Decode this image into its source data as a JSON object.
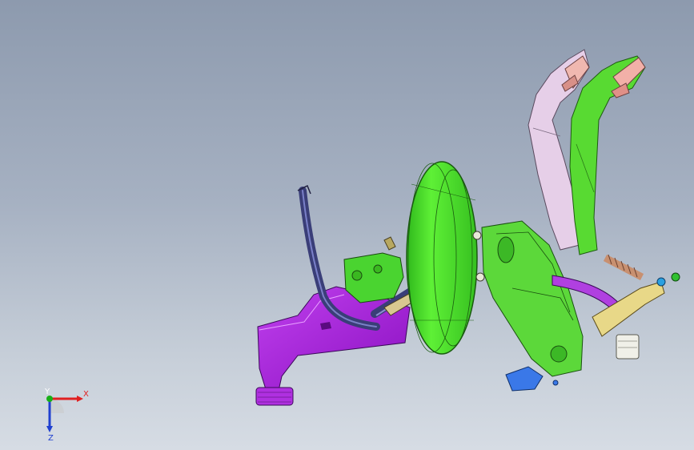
{
  "viewport": {
    "background_top": "#8d9aae",
    "background_bottom": "#d6dce4"
  },
  "triad": {
    "x_label": "X",
    "y_label": "Y",
    "z_label": "Z",
    "x_color": "#e02020",
    "y_color": "#18b018",
    "z_color": "#2040d0"
  },
  "parts": [
    {
      "name": "brake-booster",
      "color": "#4ee02a"
    },
    {
      "name": "pedal-bracket",
      "color": "#5cd83a"
    },
    {
      "name": "clutch-pedal-arm",
      "color": "#e2c8e6"
    },
    {
      "name": "brake-pedal-arm",
      "color": "#55d830"
    },
    {
      "name": "air-intake-duct",
      "color": "#a018d0"
    },
    {
      "name": "vacuum-hose",
      "color": "#3a3e78"
    },
    {
      "name": "master-cylinder",
      "color": "#48d030"
    },
    {
      "name": "linkage-bracket",
      "color": "#b8a860"
    },
    {
      "name": "pedal-spring",
      "color": "#c89070"
    },
    {
      "name": "blue-mount-bracket",
      "color": "#3070e0"
    },
    {
      "name": "white-sensor",
      "color": "#f0f0e8"
    }
  ]
}
